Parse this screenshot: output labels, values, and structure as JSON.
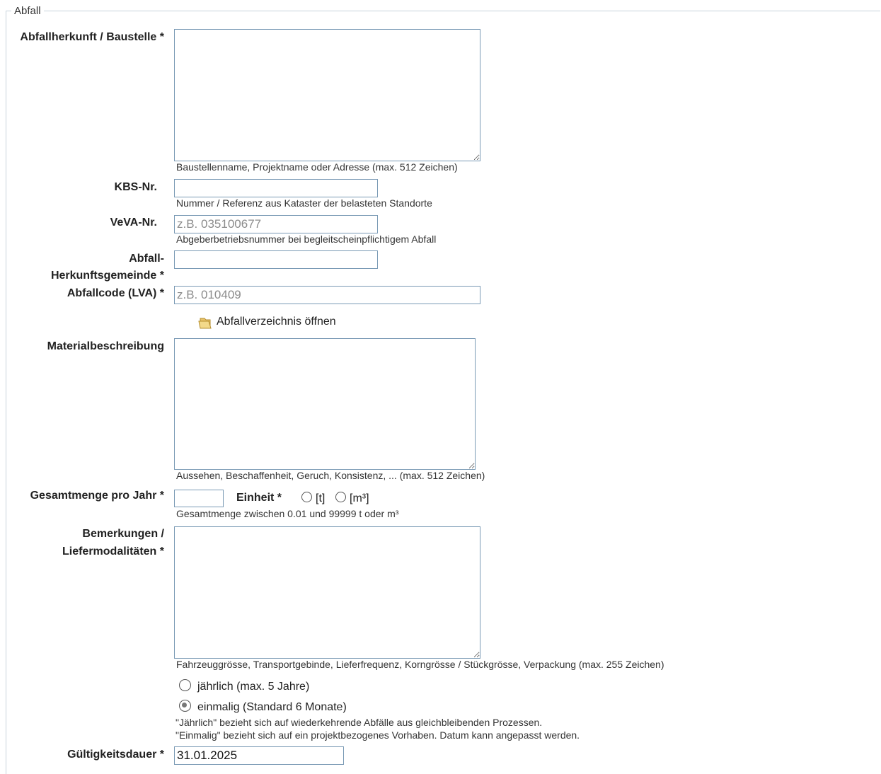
{
  "legend": "Abfall",
  "fields": {
    "herkunft": {
      "label": "Abfallherkunft / Baustelle *",
      "value": "",
      "hint": "Baustellenname, Projektname oder Adresse (max. 512 Zeichen)"
    },
    "kbs": {
      "label": "KBS-Nr.",
      "value": "",
      "hint": "Nummer / Referenz aus Kataster der belasteten Standorte"
    },
    "veva": {
      "label": "VeVA-Nr.",
      "value": "",
      "placeholder": "z.B. 035100677",
      "hint": "Abgeberbetriebsnummer bei begleitscheinpflichtigem Abfall"
    },
    "gemeinde": {
      "label_line1": "Abfall-",
      "label_line2": "Herkunftsgemeinde *",
      "value": ""
    },
    "abfallcode": {
      "label": "Abfallcode (LVA) *",
      "value": "",
      "placeholder": "z.B. 010409",
      "link": "Abfallverzeichnis öffnen"
    },
    "material": {
      "label": "Materialbeschreibung",
      "value": "",
      "hint": "Aussehen, Beschaffenheit, Geruch, Konsistenz, ... (max. 512 Zeichen)"
    },
    "menge": {
      "label": "Gesamtmenge pro Jahr *",
      "value": "",
      "einheit_label": "Einheit *",
      "unit_t": "[t]",
      "unit_m3": "[m³]",
      "hint": "Gesamtmenge zwischen 0.01 und 99999 t oder m³"
    },
    "bemerkungen": {
      "label_line1": "Bemerkungen /",
      "label_line2": "Liefermodalitäten *",
      "value": "",
      "hint": "Fahrzeuggrösse, Transportgebinde, Lieferfrequenz, Korngrösse / Stückgrösse, Verpackung (max. 255 Zeichen)"
    },
    "periodizitaet": {
      "option_jaehrlich": "jährlich (max. 5 Jahre)",
      "option_einmalig": "einmalig (Standard 6 Monate)",
      "selected": "einmalig",
      "hint_line1": "\"Jährlich\" bezieht sich auf wiederkehrende Abfälle aus gleichbleibenden Prozessen.",
      "hint_line2": "\"Einmalig\" bezieht sich auf ein projektbezogenes Vorhaben. Datum kann angepasst werden."
    },
    "gueltigkeit": {
      "label": "Gültigkeitsdauer *",
      "value": "31.01.2025"
    }
  },
  "colors": {
    "input_border": "#7a9ab5",
    "fieldset_border": "#c8d4dc",
    "folder_icon": "#e8c26a"
  },
  "icons": {
    "folder": "folder-icon"
  }
}
